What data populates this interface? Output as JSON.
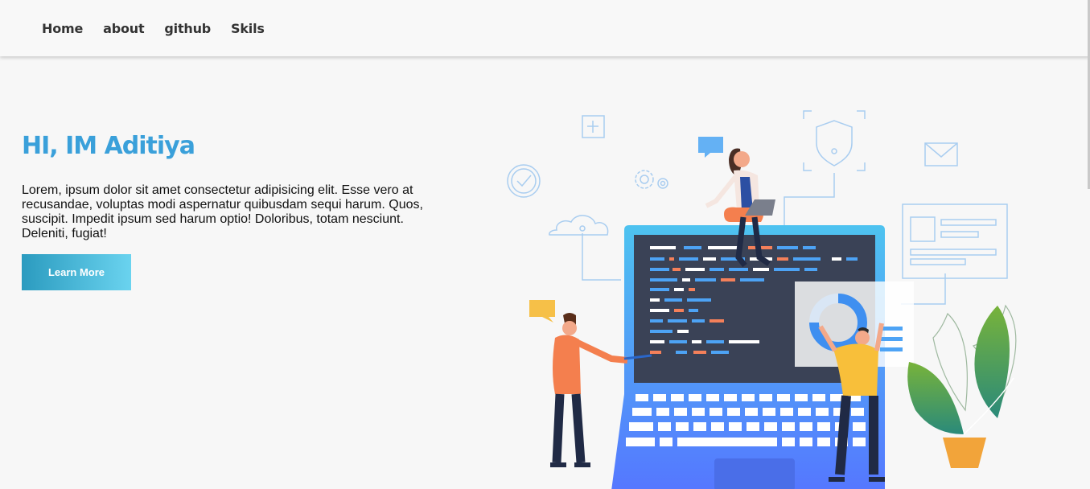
{
  "nav": {
    "items": [
      {
        "label": "Home"
      },
      {
        "label": "about"
      },
      {
        "label": "github"
      },
      {
        "label": "Skils"
      }
    ]
  },
  "hero": {
    "title": "HI, IM Aditiya",
    "description": "Lorem, ipsum dolor sit amet consectetur adipisicing elit. Esse vero at recusandae, voluptas modi aspernatur quibusdam sequi harum. Quos, suscipit. Impedit ipsum sed harum optio! Doloribus, totam nesciunt. Deleniti, fugiat!",
    "button_label": "Learn More"
  },
  "illustration": {
    "icons": [
      "plus-square-icon",
      "check-circle-icon",
      "gear-icon",
      "cloud-icon",
      "shield-icon",
      "mail-icon",
      "chat-bubble-icon",
      "donut-chart-icon"
    ]
  },
  "colors": {
    "accent": "#3aa0da",
    "button_start": "#2b9bbf",
    "button_end": "#6ad3ef",
    "laptop": "#4a8ff0",
    "screen": "#3a4256"
  }
}
